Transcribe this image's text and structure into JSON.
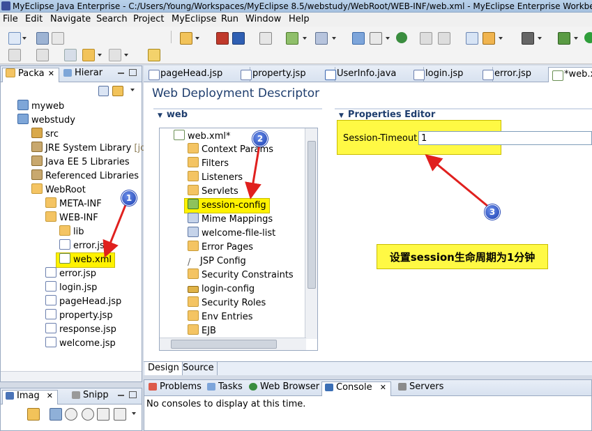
{
  "window": {
    "title": "MyEclipse Java Enterprise - C:/Users/Young/Workspaces/MyEclipse 8.5/webstudy/WebRoot/WEB-INF/web.xml - MyEclipse Enterprise Workbenc"
  },
  "menu": [
    "File",
    "Edit",
    "Navigate",
    "Search",
    "Project",
    "MyEclipse",
    "Run",
    "Window",
    "Help"
  ],
  "left_panel": {
    "tabs": [
      "Packa",
      "Hierar"
    ],
    "tree": [
      {
        "label": "myweb"
      },
      {
        "label": "webstudy"
      },
      {
        "label": "src"
      },
      {
        "label": "JRE System Library",
        "suffix": "[jdk"
      },
      {
        "label": "Java EE 5 Libraries"
      },
      {
        "label": "Referenced Libraries"
      },
      {
        "label": "WebRoot"
      },
      {
        "label": "META-INF"
      },
      {
        "label": "WEB-INF"
      },
      {
        "label": "lib"
      },
      {
        "label": "error.jsp"
      },
      {
        "label": "web.xml"
      },
      {
        "label": "error.jsp"
      },
      {
        "label": "login.jsp"
      },
      {
        "label": "pageHead.jsp"
      },
      {
        "label": "property.jsp"
      },
      {
        "label": "response.jsp"
      },
      {
        "label": "welcome.jsp"
      }
    ]
  },
  "left_bottom": {
    "tabs": [
      "Imag",
      "Snipp"
    ]
  },
  "editor_tabs": [
    "pageHead.jsp",
    "property.jsp",
    "UserInfo.java",
    "login.jsp",
    "error.jsp",
    "*web.xm"
  ],
  "editor": {
    "title": "Web Deployment Descriptor",
    "web_section": "web",
    "props_section": "Properties Editor",
    "tree": [
      "web.xml*",
      "Context Params",
      "Filters",
      "Listeners",
      "Servlets",
      "session-config",
      "Mime Mappings",
      "welcome-file-list",
      "Error Pages",
      "JSP Config",
      "Security Constraints",
      "login-config",
      "Security Roles",
      "Env Entries",
      "EJB"
    ],
    "session_timeout_label": "Session-Timeout",
    "session_timeout_value": "1",
    "note": "设置session生命周期为1分钟",
    "bottom_tabs": [
      "Design",
      "Source"
    ]
  },
  "console": {
    "tabs": [
      "Problems",
      "Tasks",
      "Web Browser",
      "Console",
      "Servers"
    ],
    "message": "No consoles to display at this time."
  },
  "badges": [
    "1",
    "2",
    "3"
  ],
  "colors": {
    "highlight": "#fff200",
    "arrow": "#e0201e",
    "title_blue": "#1f3e6e"
  }
}
